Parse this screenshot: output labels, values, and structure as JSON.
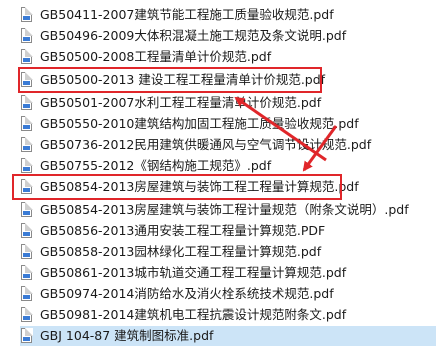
{
  "files": [
    {
      "name": "GB50411-2007建筑节能工程施工质量验收规范.pdf",
      "selected": false
    },
    {
      "name": "GB50496-2009大体积混凝土施工规范及条文说明.pdf",
      "selected": false
    },
    {
      "name": "GB50500-2008工程量清单计价规范.pdf",
      "selected": false
    },
    {
      "name": "GB50500-2013 建设工程工程量清单计价规范.pdf",
      "selected": false
    },
    {
      "name": "GB50501-2007水利工程工程量清单计价规范.pdf",
      "selected": false
    },
    {
      "name": "GB50550-2010建筑结构加固工程施工质量验收规范.pdf",
      "selected": false
    },
    {
      "name": "GB50736-2012民用建筑供暖通风与空气调节设计规范.pdf",
      "selected": false
    },
    {
      "name": "GB50755-2012《钢结构施工规范》.pdf",
      "selected": false
    },
    {
      "name": "GB50854-2013房屋建筑与装饰工程工程量计算规范.pdf",
      "selected": false
    },
    {
      "name": "GB50854-2013房屋建筑与装饰工程计量规范（附条文说明）.pdf",
      "selected": false
    },
    {
      "name": "GB50856-2013通用安装工程工程量计算规范.PDF",
      "selected": false
    },
    {
      "name": "GB50858-2013园林绿化工程工程量计算规范.pdf",
      "selected": false
    },
    {
      "name": "GB50861-2013城市轨道交通工程工程量计算规范.pdf",
      "selected": false
    },
    {
      "name": "GB50974-2014消防给水及消火栓系统技术规范.pdf",
      "selected": false
    },
    {
      "name": "GB50981-2014建筑机电工程抗震设计规范附条文.pdf",
      "selected": false
    },
    {
      "name": "GBJ 104-87 建筑制图标准.pdf",
      "selected": true
    }
  ],
  "colors": {
    "highlight": "#e0262a",
    "selection": "#cce4f7",
    "icon_badge": "#3a7bd5"
  },
  "icons": {
    "file": "pdf-file-icon"
  }
}
